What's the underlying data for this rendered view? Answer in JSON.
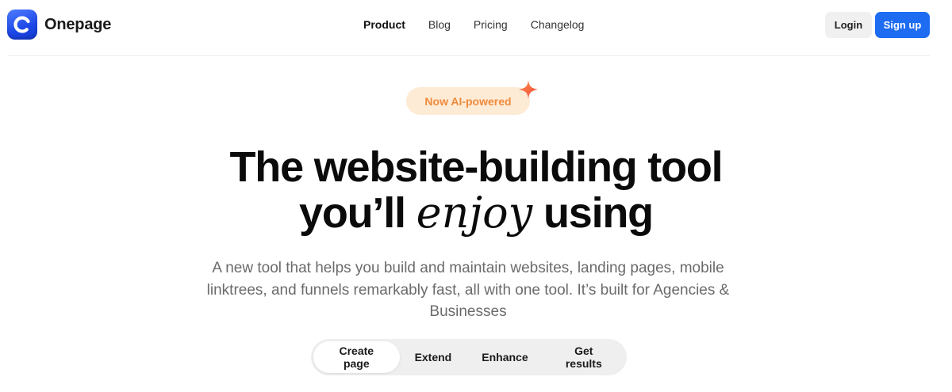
{
  "header": {
    "brand": "Onepage",
    "nav": [
      "Product",
      "Blog",
      "Pricing",
      "Changelog"
    ],
    "active_nav": "Product",
    "login_label": "Login",
    "signup_label": "Sign up"
  },
  "hero": {
    "badge": "Now AI-powered",
    "title_line1": "The website-building tool",
    "title_line2_before": "you’ll ",
    "title_line2_em": "enjoy",
    "title_line2_after": " using",
    "subtitle": "A new tool that helps you build and maintain websites, landing pages, mobile linktrees, and funnels remarkably fast, all with one tool. It’s built for Agencies & Businesses"
  },
  "tabs": {
    "items": [
      "Create page",
      "Extend",
      "Enhance",
      "Get results"
    ],
    "active": "Create page"
  },
  "colors": {
    "brand_blue": "#1d6cf2",
    "badge_bg": "#fdebd6",
    "badge_text": "#f08a3c"
  },
  "icons": {
    "logo": "onepage-logo-icon",
    "badge": "sparkle-icon"
  }
}
